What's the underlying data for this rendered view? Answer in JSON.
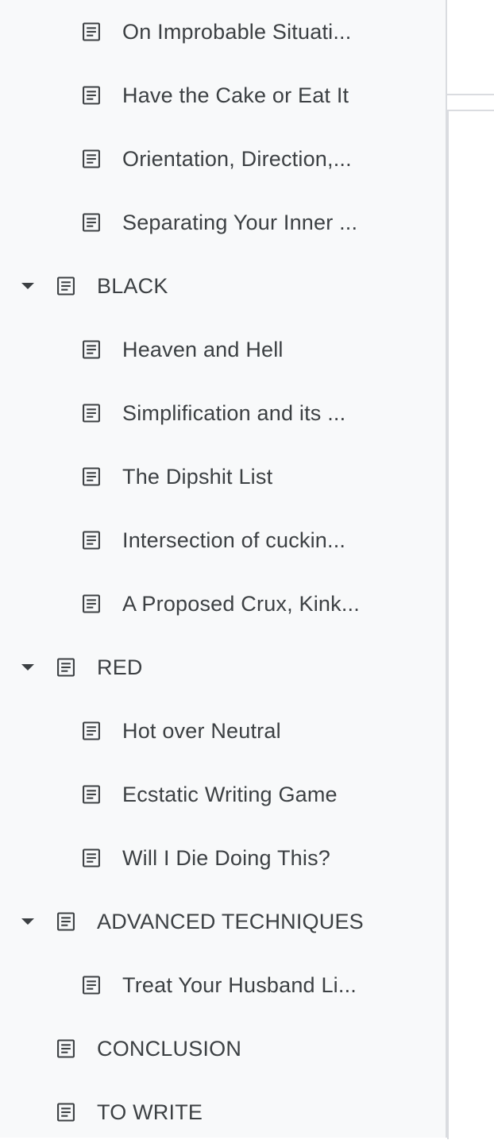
{
  "outline": {
    "items": [
      {
        "label": "On Improbable Situati...",
        "level": 2,
        "collapsible": false
      },
      {
        "label": "Have the Cake or Eat It",
        "level": 2,
        "collapsible": false
      },
      {
        "label": "Orientation, Direction,...",
        "level": 2,
        "collapsible": false
      },
      {
        "label": "Separating Your Inner ...",
        "level": 2,
        "collapsible": false
      },
      {
        "label": "BLACK",
        "level": 1,
        "collapsible": true
      },
      {
        "label": "Heaven and Hell",
        "level": 2,
        "collapsible": false
      },
      {
        "label": "Simplification and its ...",
        "level": 2,
        "collapsible": false
      },
      {
        "label": "The Dipshit List",
        "level": 2,
        "collapsible": false
      },
      {
        "label": "Intersection of cuckin...",
        "level": 2,
        "collapsible": false
      },
      {
        "label": "A Proposed Crux, Kink...",
        "level": 2,
        "collapsible": false
      },
      {
        "label": "RED",
        "level": 1,
        "collapsible": true
      },
      {
        "label": "Hot over Neutral",
        "level": 2,
        "collapsible": false
      },
      {
        "label": "Ecstatic Writing Game",
        "level": 2,
        "collapsible": false
      },
      {
        "label": "Will I Die Doing This?",
        "level": 2,
        "collapsible": false
      },
      {
        "label": "ADVANCED TECHNIQUES",
        "level": 1,
        "collapsible": true
      },
      {
        "label": "Treat Your Husband Li...",
        "level": 2,
        "collapsible": false
      },
      {
        "label": "CONCLUSION",
        "level": 1,
        "collapsible": false
      },
      {
        "label": "TO WRITE",
        "level": 1,
        "collapsible": false
      }
    ]
  },
  "icons": {
    "document": "document-icon",
    "caret": "caret-down-icon"
  },
  "colors": {
    "sidebar_bg": "#f8f9fa",
    "text": "#3c4043",
    "icon": "#3c4043",
    "divider": "#dadce0"
  }
}
